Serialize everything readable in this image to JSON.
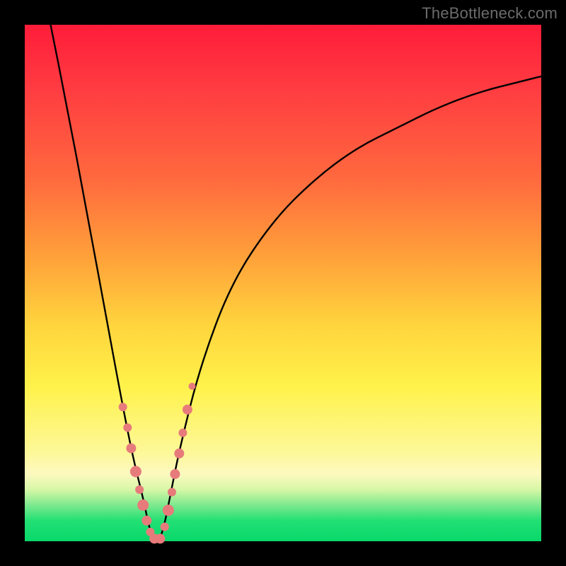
{
  "watermark": "TheBottleneck.com",
  "colors": {
    "marker": "#e77b7b",
    "curve": "#000000",
    "frame": "#000000"
  },
  "chart_data": {
    "type": "line",
    "title": "",
    "xlabel": "",
    "ylabel": "",
    "xlim": [
      0,
      100
    ],
    "ylim": [
      0,
      100
    ],
    "note": "Bottleneck-style V curve; minimum near x≈25 at y≈0. Axis values are estimated from pixel positions; the source image has no tick labels.",
    "series": [
      {
        "name": "bottleneck-curve",
        "x": [
          5,
          8,
          12,
          16,
          19,
          21,
          23,
          24,
          25,
          26,
          27,
          28,
          30,
          34,
          40,
          48,
          56,
          64,
          72,
          80,
          88,
          96,
          100
        ],
        "y": [
          100,
          85,
          64,
          42,
          26,
          16,
          8,
          3,
          0,
          0,
          3,
          8,
          18,
          34,
          50,
          62,
          70,
          76,
          80,
          84,
          87,
          89,
          90
        ]
      }
    ],
    "markers": {
      "name": "scatter-points",
      "points": [
        {
          "x": 19.0,
          "y": 26.0,
          "r": 6
        },
        {
          "x": 19.9,
          "y": 22.0,
          "r": 6
        },
        {
          "x": 20.6,
          "y": 18.0,
          "r": 7
        },
        {
          "x": 21.5,
          "y": 13.5,
          "r": 8
        },
        {
          "x": 22.2,
          "y": 10.0,
          "r": 6
        },
        {
          "x": 22.9,
          "y": 7.0,
          "r": 8
        },
        {
          "x": 23.6,
          "y": 4.0,
          "r": 7
        },
        {
          "x": 24.3,
          "y": 1.8,
          "r": 6
        },
        {
          "x": 25.1,
          "y": 0.5,
          "r": 7
        },
        {
          "x": 26.2,
          "y": 0.5,
          "r": 7
        },
        {
          "x": 27.1,
          "y": 2.8,
          "r": 6
        },
        {
          "x": 27.8,
          "y": 6.0,
          "r": 8
        },
        {
          "x": 28.5,
          "y": 9.5,
          "r": 6
        },
        {
          "x": 29.1,
          "y": 13.0,
          "r": 7
        },
        {
          "x": 29.9,
          "y": 17.0,
          "r": 7
        },
        {
          "x": 30.6,
          "y": 21.0,
          "r": 6
        },
        {
          "x": 31.5,
          "y": 25.5,
          "r": 7
        },
        {
          "x": 32.4,
          "y": 30.0,
          "r": 5
        }
      ]
    }
  }
}
